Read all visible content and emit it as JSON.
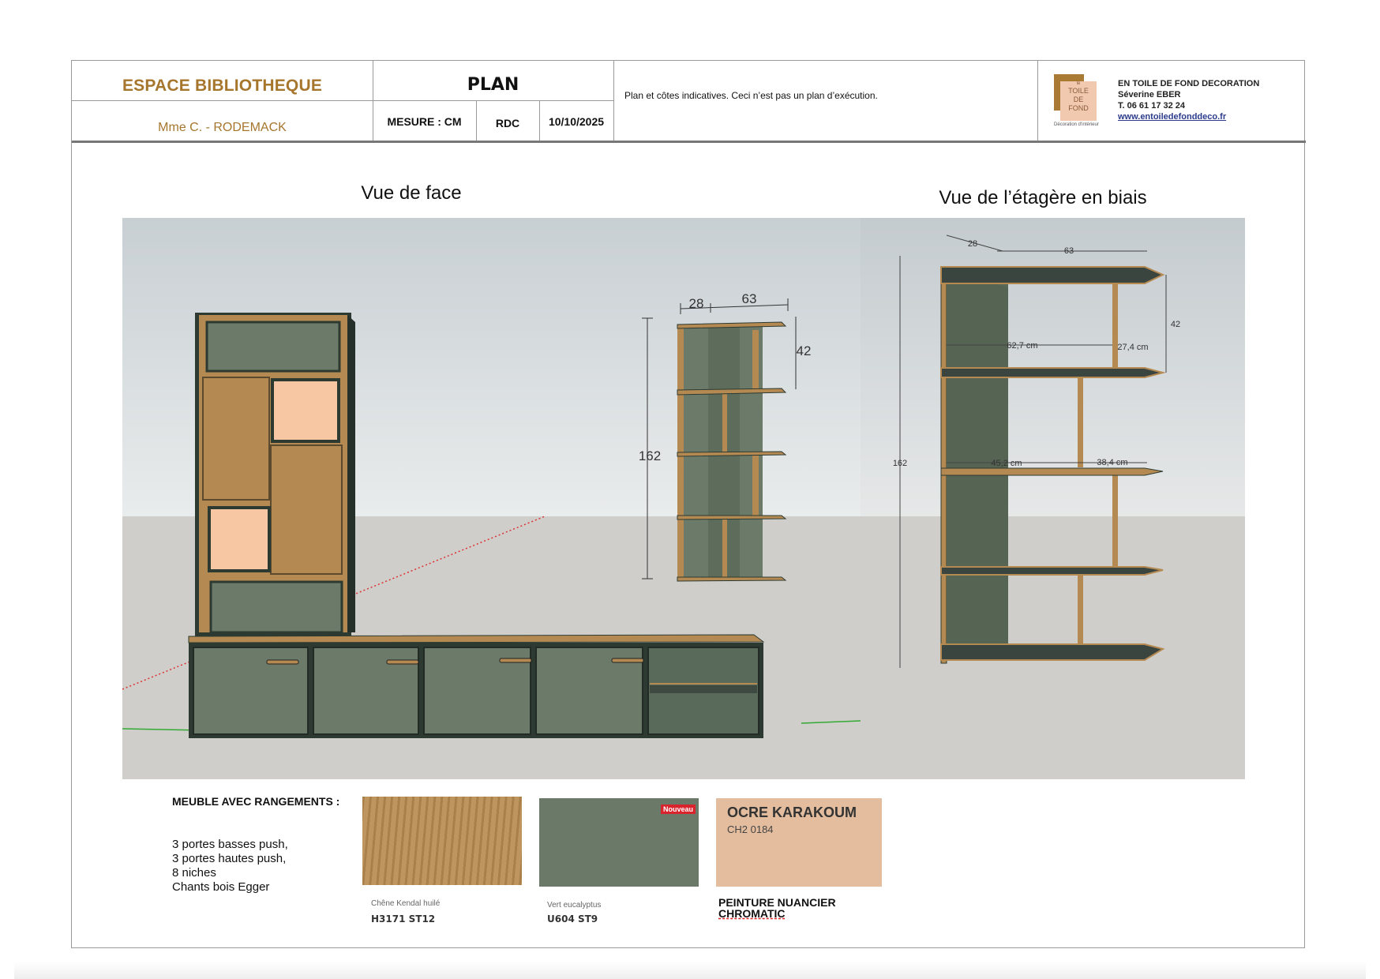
{
  "header": {
    "project_title": "ESPACE BIBLIOTHEQUE",
    "client": "Mme C. -  RODEMACK",
    "plan_label": "PLAN",
    "measure_label": "MESURE : CM",
    "level": "RDC",
    "date": "10/10/2025",
    "disclaimer": "Plan et côtes indicatives. Ceci n’est pas un plan d’exécution.",
    "company": {
      "logo_lines": [
        "le",
        "TOILE",
        "DE",
        "FOND",
        "Décoration d'intérieur"
      ],
      "name": "EN TOILE DE FOND DECORATION",
      "person": "Séverine EBER",
      "phone": "T. 06 61 17 32 24",
      "website": "www.entoiledefonddeco.fr"
    }
  },
  "views": {
    "front_title": "Vue de face",
    "angled_title": "Vue de l’étagère en biais",
    "front_dims": {
      "depth": "28",
      "width": "63",
      "shelf": "42",
      "height": "162"
    },
    "angled_dims": {
      "depth": "28",
      "width": "63",
      "shelf": "42",
      "height": "162",
      "inner_top": "62,7 cm",
      "side_top": "27,4 cm",
      "inner_mid": "45,2 cm",
      "side_mid": "38,4 cm"
    }
  },
  "legend": {
    "title": "MEUBLE AVEC RANGEMENTS :",
    "lines": [
      "3 portes basses push,",
      "3 portes hautes push,",
      "8 niches",
      "Chants bois Egger"
    ]
  },
  "swatches": [
    {
      "caption": "Chêne Kendal huilé",
      "ref": "H3171 ST12",
      "color": "#b58a52"
    },
    {
      "caption": "Vert eucalyptus",
      "ref": "U604 ST9",
      "color": "#6b7968",
      "badge": "Nouveau"
    },
    {
      "name": "OCRE KARAKOUM",
      "code": "CH2 0184",
      "color": "#e3bd9e",
      "label_line1": "PEINTURE NUANCIER",
      "label_line2": "CHROMATIC"
    }
  ]
}
